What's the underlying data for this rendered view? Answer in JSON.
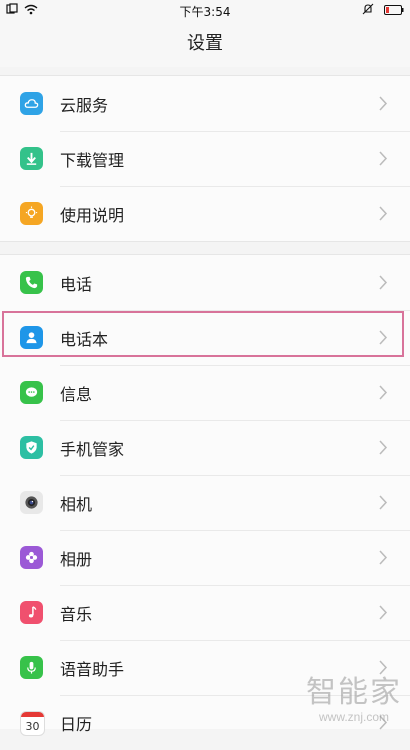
{
  "status": {
    "time": "下午3:54"
  },
  "title": "设置",
  "groups": [
    [
      {
        "label": "云服务",
        "icon": "cloud-icon",
        "color": "#2fa3e6"
      },
      {
        "label": "下载管理",
        "icon": "download-icon",
        "color": "#33c28a"
      },
      {
        "label": "使用说明",
        "icon": "lightbulb-icon",
        "color": "#f5a623"
      }
    ],
    [
      {
        "label": "电话",
        "icon": "phone-icon",
        "color": "#37c24a"
      },
      {
        "label": "电话本",
        "icon": "contacts-icon",
        "color": "#1e96e8"
      },
      {
        "label": "信息",
        "icon": "message-icon",
        "color": "#37c24a"
      },
      {
        "label": "手机管家",
        "icon": "shield-icon",
        "color": "#2dbfa3"
      },
      {
        "label": "相机",
        "icon": "camera-icon",
        "color": "#666666"
      },
      {
        "label": "相册",
        "icon": "flower-icon",
        "color": "#9b59d6"
      },
      {
        "label": "音乐",
        "icon": "music-icon",
        "color": "#f0506e"
      },
      {
        "label": "语音助手",
        "icon": "microphone-icon",
        "color": "#37c24a"
      },
      {
        "label": "日历",
        "icon": "calendar-icon",
        "color": "#ffffff",
        "day": "30"
      }
    ]
  ],
  "watermark": {
    "brand": "智能家",
    "url": "www.znj.com"
  }
}
